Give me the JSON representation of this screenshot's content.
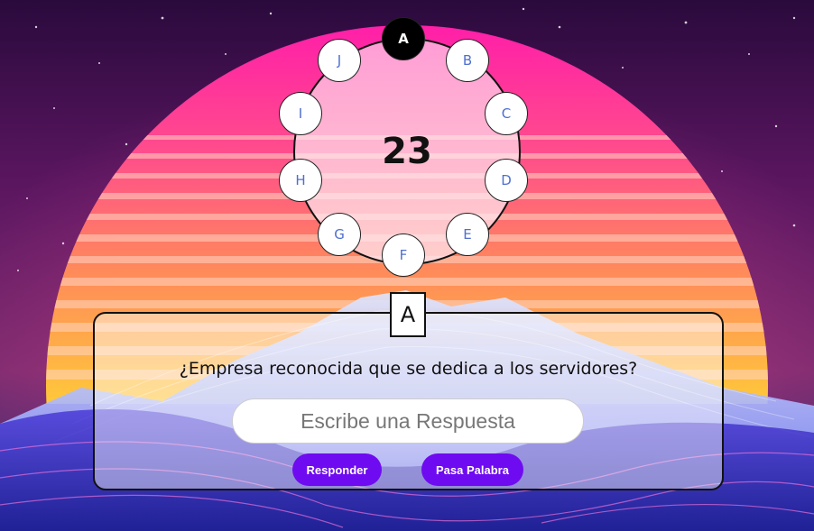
{
  "game": {
    "counter": "23",
    "current_letter": "A",
    "active_letter": "A",
    "letters": [
      "A",
      "B",
      "C",
      "D",
      "E",
      "F",
      "G",
      "H",
      "I",
      "J"
    ]
  },
  "question": {
    "text": "¿Empresa reconocida que se dedica a los servidores?"
  },
  "answer": {
    "placeholder": "Escribe una Respuesta",
    "value": ""
  },
  "buttons": {
    "respond_label": "Responder",
    "pass_label": "Pasa Palabra"
  },
  "colors": {
    "accent": "#6f0bf0",
    "letter_text": "#4f6fd0",
    "active_letter_bg": "#000000"
  }
}
